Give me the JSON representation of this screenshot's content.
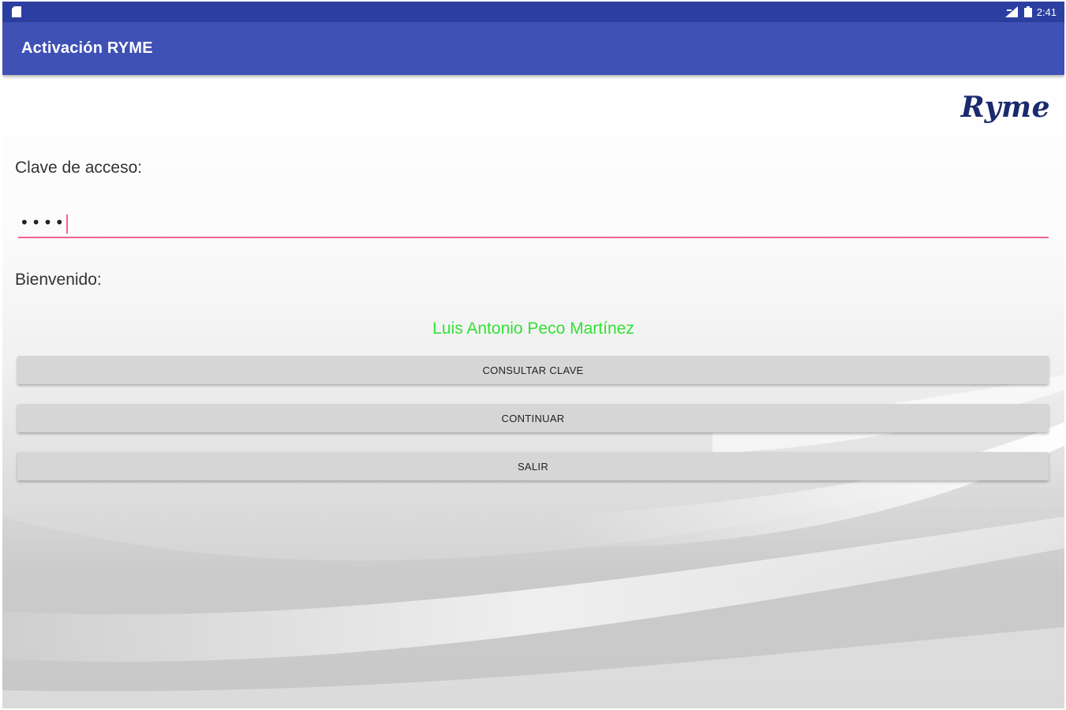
{
  "status_bar": {
    "time": "2:41",
    "icons": [
      "sim-card-icon",
      "signal-icon",
      "battery-icon"
    ]
  },
  "app_bar": {
    "title": "Activación RYME"
  },
  "logo": {
    "text": "Ryme"
  },
  "form": {
    "access_key_label": "Clave de acceso:",
    "access_key_value": "••••",
    "welcome_label": "Bienvenido:",
    "user_name": "Luis Antonio Peco Martínez"
  },
  "buttons": {
    "consultar": "CONSULTAR CLAVE",
    "continuar": "CONTINUAR",
    "salir": "SALIR"
  },
  "colors": {
    "status_bar": "#2c3fa0",
    "app_bar": "#3f51b5",
    "accent": "#f06292",
    "user_name": "#33e033",
    "logo": "#1a2a6e",
    "button": "#d6d6d6"
  }
}
